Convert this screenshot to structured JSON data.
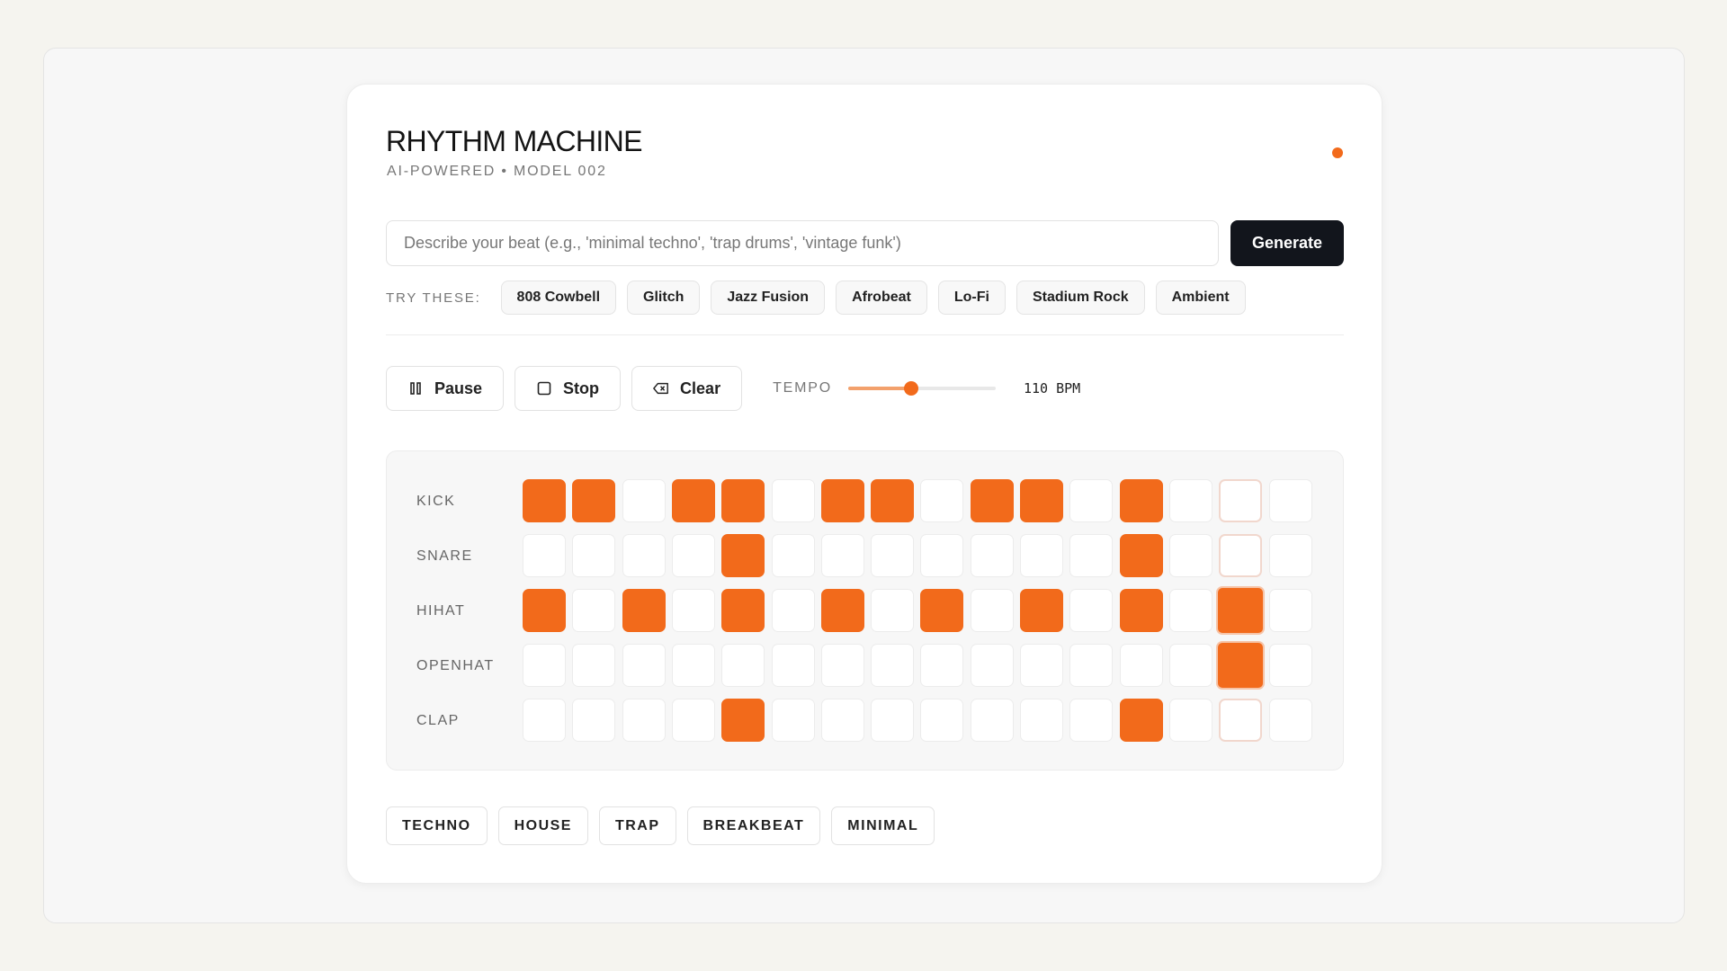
{
  "header": {
    "title": "RHYTHM MACHINE",
    "subtitle": "AI-POWERED • MODEL 002",
    "status_color": "#f26a1b"
  },
  "prompt": {
    "placeholder": "Describe your beat (e.g., 'minimal techno', 'trap drums', 'vintage funk')",
    "value": "",
    "generate_label": "Generate"
  },
  "suggestions": {
    "label": "TRY THESE:",
    "items": [
      "808 Cowbell",
      "Glitch",
      "Jazz Fusion",
      "Afrobeat",
      "Lo-Fi",
      "Stadium Rock",
      "Ambient"
    ]
  },
  "transport": {
    "pause_label": "Pause",
    "stop_label": "Stop",
    "clear_label": "Clear",
    "tempo_label": "TEMPO",
    "tempo_value": "110 BPM",
    "tempo_fraction": 0.43,
    "icons": [
      "pause-icon",
      "stop-icon",
      "backspace-icon"
    ]
  },
  "sequencer": {
    "steps": 16,
    "playhead_step": 14,
    "active_color": "#f26a1b",
    "tracks": [
      {
        "name": "KICK",
        "pattern": [
          1,
          1,
          0,
          1,
          1,
          0,
          1,
          1,
          0,
          1,
          1,
          0,
          1,
          0,
          0,
          0
        ]
      },
      {
        "name": "SNARE",
        "pattern": [
          0,
          0,
          0,
          0,
          1,
          0,
          0,
          0,
          0,
          0,
          0,
          0,
          1,
          0,
          0,
          0
        ]
      },
      {
        "name": "HIHAT",
        "pattern": [
          1,
          0,
          1,
          0,
          1,
          0,
          1,
          0,
          1,
          0,
          1,
          0,
          1,
          0,
          1,
          0
        ]
      },
      {
        "name": "OPENHAT",
        "pattern": [
          0,
          0,
          0,
          0,
          0,
          0,
          0,
          0,
          0,
          0,
          0,
          0,
          0,
          0,
          1,
          0
        ]
      },
      {
        "name": "CLAP",
        "pattern": [
          0,
          0,
          0,
          0,
          1,
          0,
          0,
          0,
          0,
          0,
          0,
          0,
          1,
          0,
          0,
          0
        ]
      }
    ]
  },
  "presets": {
    "items": [
      "TECHNO",
      "HOUSE",
      "TRAP",
      "BREAKBEAT",
      "MINIMAL"
    ]
  }
}
